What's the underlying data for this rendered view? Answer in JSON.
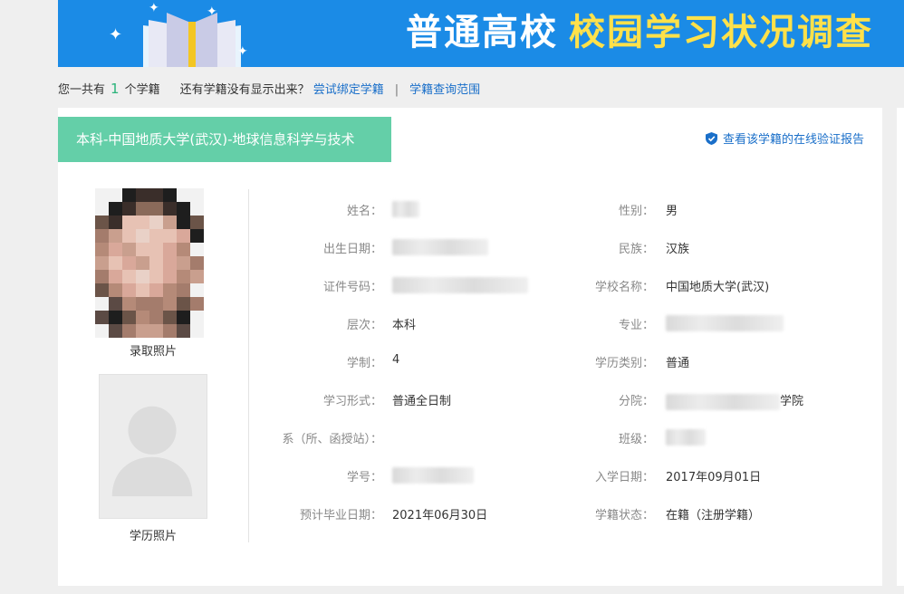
{
  "banner": {
    "title_white": "普通高校",
    "title_yellow": "校园学习状况调查"
  },
  "summary": {
    "prefix": "您一共有",
    "count": "1",
    "suffix": "个学籍",
    "question": "还有学籍没有显示出来？",
    "bind_link": "尝试绑定学籍",
    "separator": "|",
    "scope_link": "学籍查询范围"
  },
  "record": {
    "tag": "本科-中国地质大学(武汉)-地球信息科学与技术",
    "verify_link": "查看该学籍的在线验证报告",
    "photo_caption_1": "录取照片",
    "photo_caption_2": "学历照片",
    "fields": {
      "name": {
        "label": "姓名：",
        "value": ""
      },
      "gender": {
        "label": "性别：",
        "value": "男"
      },
      "birth": {
        "label": "出生日期：",
        "value": ""
      },
      "ethnicity": {
        "label": "民族：",
        "value": "汉族"
      },
      "id_no": {
        "label": "证件号码：",
        "value": ""
      },
      "school": {
        "label": "学校名称：",
        "value": "中国地质大学(武汉)"
      },
      "level": {
        "label": "层次：",
        "value": "本科"
      },
      "major": {
        "label": "专业：",
        "value": ""
      },
      "duration": {
        "label": "学制：",
        "value": "4"
      },
      "category": {
        "label": "学历类别：",
        "value": "普通"
      },
      "form": {
        "label": "学习形式：",
        "value": "普通全日制"
      },
      "branch": {
        "label": "分院：",
        "value": "学院"
      },
      "dept": {
        "label": "系（所、函授站）：",
        "value": ""
      },
      "class": {
        "label": "班级：",
        "value": ""
      },
      "student_no": {
        "label": "学号：",
        "value": ""
      },
      "enroll_date": {
        "label": "入学日期：",
        "value": "2017年09月01日"
      },
      "grad_date": {
        "label": "预计毕业日期：",
        "value": "2021年06月30日"
      },
      "status": {
        "label": "学籍状态：",
        "value": "在籍（注册学籍）"
      }
    }
  },
  "colors": {
    "banner_bg": "#1b8be6",
    "tag_bg": "#64cfa8",
    "link": "#1a6fc9",
    "count": "#2ab37a"
  }
}
